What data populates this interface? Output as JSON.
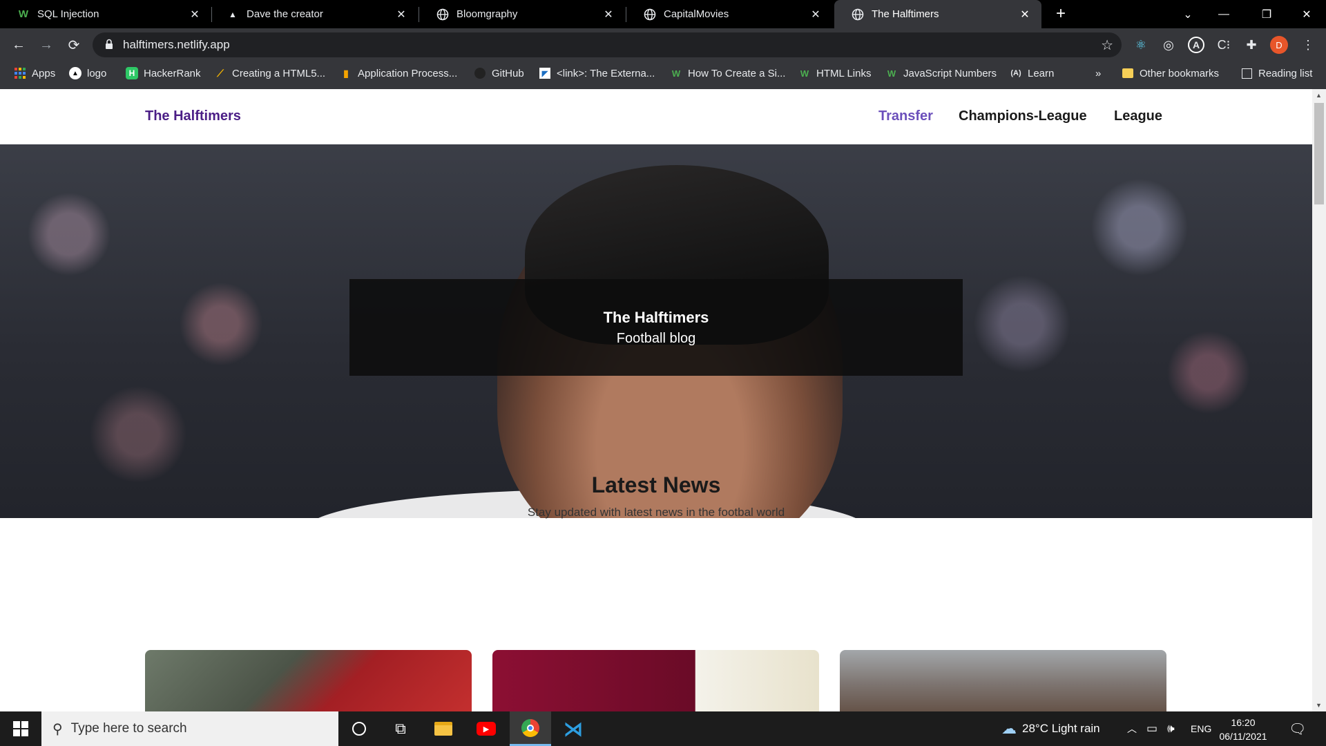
{
  "browser": {
    "tabs": [
      {
        "title": "SQL Injection",
        "favicon": "w3schools-icon"
      },
      {
        "title": "Dave the creator",
        "favicon": "triangle-icon"
      },
      {
        "title": "Bloomgraphy",
        "favicon": "globe-icon"
      },
      {
        "title": "CapitalMovies",
        "favicon": "globe-icon"
      },
      {
        "title": "The Halftimers",
        "favicon": "globe-icon",
        "active": true
      }
    ],
    "url": "halftimers.netlify.app",
    "profile_initial": "D",
    "bookmarks": [
      {
        "label": "Apps",
        "icon": "apps-grid-icon"
      },
      {
        "label": "logo",
        "icon": "triangle-icon"
      },
      {
        "label": "HackerRank",
        "icon": "hackerrank-icon"
      },
      {
        "label": "Creating a HTML5...",
        "icon": "chart-icon"
      },
      {
        "label": "Application Process...",
        "icon": "bookmark-icon"
      },
      {
        "label": "GitHub",
        "icon": "github-icon"
      },
      {
        "label": "<link>: The Externa...",
        "icon": "mdn-icon"
      },
      {
        "label": "How To Create a Si...",
        "icon": "w3schools-icon"
      },
      {
        "label": "HTML Links",
        "icon": "w3schools-icon"
      },
      {
        "label": "JavaScript Numbers",
        "icon": "w3schools-icon"
      },
      {
        "label": "Learn",
        "icon": "angular-icon"
      }
    ],
    "overflow_label": "»",
    "other_bookmarks": "Other bookmarks",
    "reading_list": "Reading list"
  },
  "site": {
    "brand": "The Halftimers",
    "nav": [
      "Transfer",
      "Champions-League",
      "League"
    ],
    "hero_title": "The Halftimers",
    "hero_subtitle": "Football blog",
    "news_heading": "Latest News",
    "news_subheading": "Stay updated with latest news in the footbal world"
  },
  "taskbar": {
    "search_placeholder": "Type here to search",
    "weather": "28°C  Light rain",
    "language": "ENG",
    "time": "16:20",
    "date": "06/11/2021"
  },
  "colors": {
    "brand": "#4b1e86",
    "nav_active": "#6b4fbb",
    "chrome_dark": "#35363a"
  }
}
